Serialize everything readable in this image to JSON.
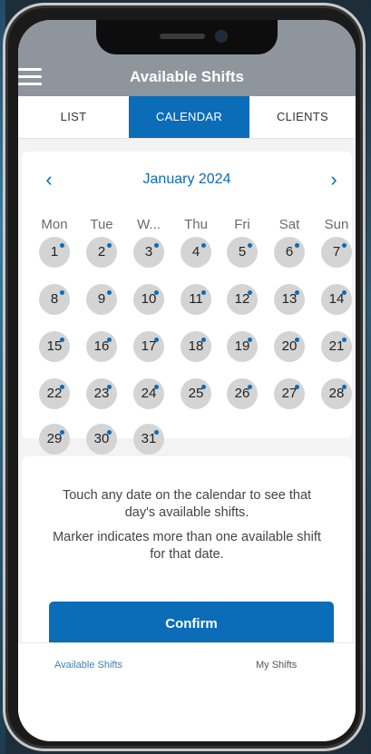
{
  "header": {
    "title": "Available Shifts"
  },
  "tabs": [
    {
      "label": "LIST"
    },
    {
      "label": "CALENDAR"
    },
    {
      "label": "CLIENTS"
    }
  ],
  "calendar": {
    "month_label": "January 2024",
    "weekdays": [
      "Mon",
      "Tue",
      "W...",
      "Thu",
      "Fri",
      "Sat",
      "Sun"
    ],
    "days": [
      "1",
      "2",
      "3",
      "4",
      "5",
      "6",
      "7",
      "8",
      "9",
      "10",
      "11",
      "12",
      "13",
      "14",
      "15",
      "16",
      "17",
      "18",
      "19",
      "20",
      "21",
      "22",
      "23",
      "24",
      "25",
      "26",
      "27",
      "28",
      "29",
      "30",
      "31"
    ]
  },
  "info": {
    "line1": "Touch any date on the calendar to see that day's available shifts.",
    "line2": "Marker indicates more than one available shift for that date.",
    "confirm_label": "Confirm"
  },
  "bottom_nav": [
    {
      "label": "Available Shifts"
    },
    {
      "label": "My Shifts"
    }
  ],
  "colors": {
    "accent": "#0b6cb8",
    "header_bg": "#8e959c",
    "day_bg": "#d4d4d4"
  }
}
